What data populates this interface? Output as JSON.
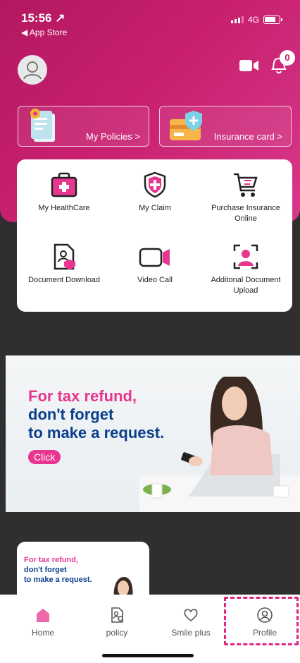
{
  "status_bar": {
    "time": "15:56 ↗",
    "back_label": "◀ App Store",
    "network": "4G"
  },
  "header": {
    "notification_count": "0"
  },
  "cards": [
    {
      "label": "My Policies >"
    },
    {
      "label": "Insurance card >"
    }
  ],
  "services": [
    {
      "label": "My HealthCare"
    },
    {
      "label": "My Claim"
    },
    {
      "label": "Purchase Insurance Online"
    },
    {
      "label": "Document Download"
    },
    {
      "label": "Video Call"
    },
    {
      "label": "Additonal Document Upload"
    }
  ],
  "banner": {
    "line1": "For tax refund,",
    "line2": "don't forget",
    "line3": "to make a request.",
    "cta": "Click"
  },
  "mini_banner": {
    "line1": "For tax refund,",
    "line2": "don't forget",
    "line3": "to make a request."
  },
  "tabs": [
    {
      "label": "Home",
      "active": true
    },
    {
      "label": "policy",
      "active": false
    },
    {
      "label": "Smile plus",
      "active": false
    },
    {
      "label": "Profile",
      "active": false
    }
  ],
  "colors": {
    "brand_pink": "#c8206f",
    "accent_pink": "#e8358f",
    "navy": "#0b3f8c"
  }
}
